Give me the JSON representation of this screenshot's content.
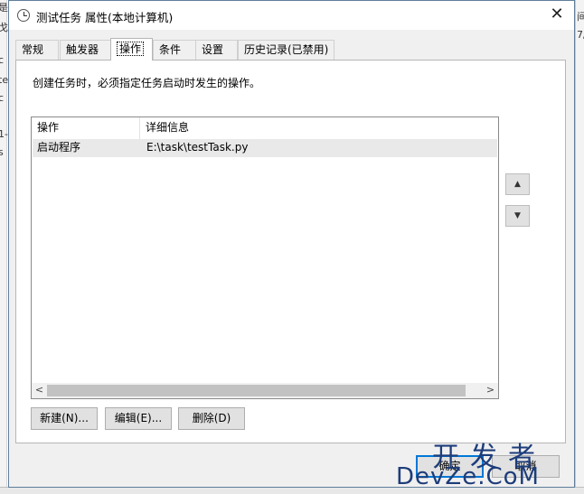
{
  "window": {
    "title": "测试任务 属性(本地计算机)",
    "close_label": "✕"
  },
  "tabs": [
    {
      "label": "常规"
    },
    {
      "label": "触发器"
    },
    {
      "label": "操作",
      "active": true
    },
    {
      "label": "条件"
    },
    {
      "label": "设置"
    },
    {
      "label": "历史记录(已禁用)"
    }
  ],
  "actions_page": {
    "description": "创建任务时，必须指定任务启动时发生的操作。",
    "list": {
      "columns": [
        "操作",
        "详细信息"
      ],
      "rows": [
        {
          "action": "启动程序",
          "details": "E:\\task\\testTask.py"
        }
      ]
    },
    "move_up_icon": "▲",
    "move_down_icon": "▼",
    "buttons": {
      "new_label": "新建(N)...",
      "edit_label": "编辑(E)...",
      "delete_label": "删除(D)"
    }
  },
  "footer": {
    "ok_label": "确定",
    "cancel_label": "取消"
  },
  "watermark": {
    "top": "开发者",
    "bottom": "DevZe.CoM"
  },
  "background": {
    "left_fragments": [
      "是",
      "戈",
      "c",
      "te",
      "c",
      "1-",
      "s"
    ],
    "right_fragments": [
      "间",
      "7/"
    ]
  }
}
